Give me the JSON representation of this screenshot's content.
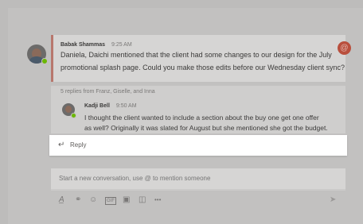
{
  "post": {
    "author": "Babak Shammas",
    "time": "9:25 AM",
    "lines": [
      "Daniela, Daichi mentioned that the client had some changes to our design for the July",
      "promotional splash page. Could you make those edits before our Wednesday client sync?"
    ],
    "mention_symbol": "@"
  },
  "replies_summary": "5 replies from Franz, Giselle, and Inna",
  "reply": {
    "author": "Kadji Bell",
    "time": "9:50 AM",
    "lines": [
      "I thought the client wanted to include a section about the buy one get one offer",
      "as well? Originally it was slated for August but she mentioned she got the budget."
    ]
  },
  "reply_button": {
    "label": "Reply",
    "icon": "reply-arrow-icon"
  },
  "compose": {
    "placeholder": "Start a new conversation, use @ to mention someone"
  },
  "toolbar": {
    "icons": [
      "format-icon",
      "attach-icon",
      "emoji-icon",
      "gif-icon",
      "sticker-icon",
      "meet-now-icon",
      "more-icon"
    ],
    "more_label": "•••"
  },
  "colors": {
    "accent": "#b8776d",
    "mention": "#b94f3d",
    "presence": "#6bb700"
  }
}
